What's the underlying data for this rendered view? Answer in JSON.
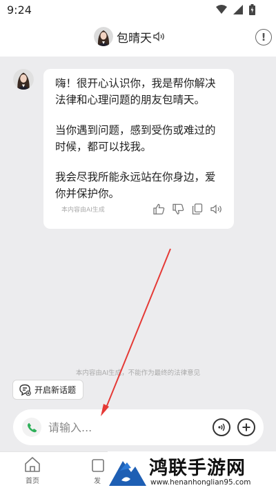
{
  "status_bar": {
    "time": "9:24",
    "icons": [
      "wifi-icon",
      "cell-signal-icon",
      "battery-icon"
    ]
  },
  "header": {
    "bot_name": "包晴天",
    "icons": [
      "avatar",
      "speaker-icon",
      "info-icon"
    ],
    "info_glyph": "!"
  },
  "message": {
    "paragraphs": [
      "嗨！很开心认识你，我是帮你解决法律和心理问题的朋友包晴天。",
      "当你遇到问题，感到受伤或难过的时候，都可以找我。",
      "我会尽我所能永远站在你身边，爱你并保护你。"
    ],
    "ai_note": "本内容由AI生成",
    "actions": [
      "thumbs-up-icon",
      "thumbs-down-icon",
      "copy-icon",
      "speaker-icon"
    ]
  },
  "disclaimer": "本内容由AI生成，不能作为最终的法律意见",
  "new_topic": {
    "label": "开启新话题",
    "icon": "new-chat-icon"
  },
  "input": {
    "placeholder": "请输入...",
    "icons": [
      "phone-icon",
      "voice-icon",
      "plus-icon"
    ]
  },
  "bottom_nav": {
    "items": [
      {
        "label": "首页",
        "icon": "home-icon"
      },
      {
        "label": "发",
        "icon": "discover-icon"
      }
    ]
  },
  "watermark": {
    "title": "鸿联手游网",
    "url": "www.henanhonglian95.com"
  },
  "colors": {
    "background": "#ececee",
    "arrow": "#e53935",
    "phone_icon": "#2fb05a",
    "surface": "#ffffff"
  }
}
